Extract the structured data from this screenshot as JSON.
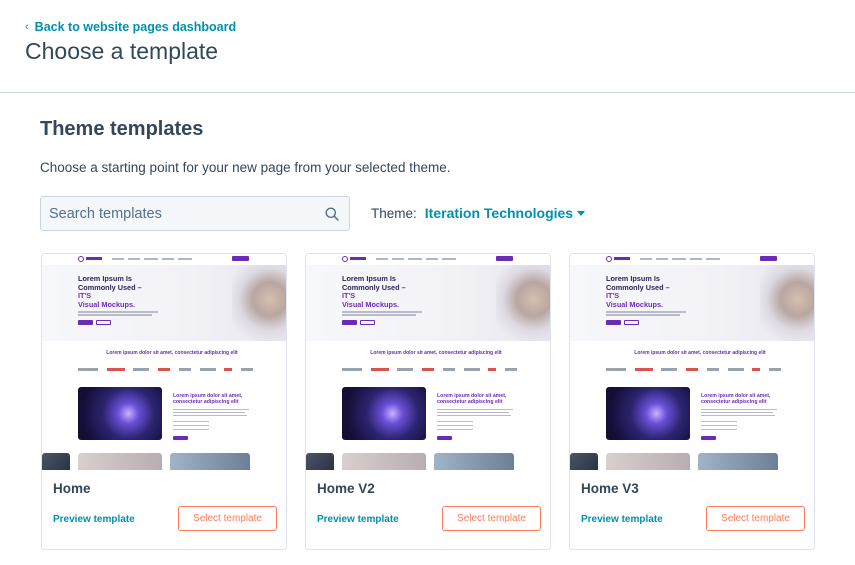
{
  "header": {
    "back_label": "Back to website pages dashboard",
    "title": "Choose a template"
  },
  "section": {
    "title": "Theme templates",
    "subtitle": "Choose a starting point for your new page from your selected theme."
  },
  "search": {
    "placeholder": "Search templates",
    "value": ""
  },
  "theme": {
    "label": "Theme:",
    "value": "Iteration Technologies"
  },
  "cards": [
    {
      "name": "Home",
      "preview_label": "Preview template",
      "select_label": "Select template"
    },
    {
      "name": "Home V2",
      "preview_label": "Preview template",
      "select_label": "Select template"
    },
    {
      "name": "Home V3",
      "preview_label": "Preview template",
      "select_label": "Select template"
    }
  ],
  "thumbnail": {
    "hero_line1": "Lorem Ipsum Is",
    "hero_line2": "Commonly Used –",
    "hero_line3": "IT'S",
    "hero_line4": "Visual Mockups.",
    "tagline": "Lorem ipsum dolor sit amet, consectetur adipiscing elit",
    "section_heading": "Lorem ipsum dolor sit amet, consectetur adipiscing elit"
  },
  "colors": {
    "link": "#0091ae",
    "accent_button": "#ff7a59",
    "text": "#33475b",
    "brand_purple": "#6a2bb5"
  },
  "icons": {
    "search": "search-icon",
    "back": "chevron-left-icon",
    "dropdown": "caret-down-icon"
  }
}
